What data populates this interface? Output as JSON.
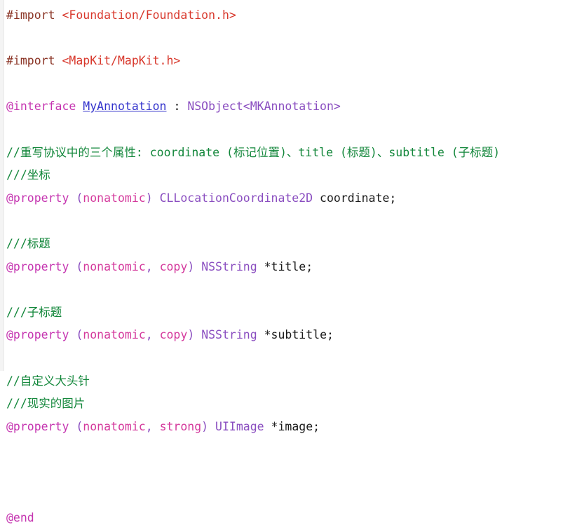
{
  "document": {
    "language": "Objective-C",
    "kind": "header-file",
    "colors": {
      "background": "#ffffff",
      "gutter": "#f4f4f4",
      "preprocessor": "#8a3324",
      "header_path": "#d8372b",
      "keyword": "#c534b0",
      "class_link": "#3333cc",
      "type": "#8a4ec0",
      "property_attribute": "#d4399c",
      "plain_text": "#1a1a1a",
      "comment": "#13873b"
    }
  },
  "code": {
    "lines": [
      {
        "index": 0,
        "plain": "#import <Foundation/Foundation.h>",
        "tokens": [
          {
            "text": "#import",
            "type": "preproc"
          },
          {
            "text": " ",
            "type": "plain"
          },
          {
            "text": "<Foundation/Foundation.h>",
            "type": "header"
          }
        ]
      },
      {
        "index": 1,
        "plain": "",
        "tokens": []
      },
      {
        "index": 2,
        "plain": "#import <MapKit/MapKit.h>",
        "tokens": [
          {
            "text": "#import",
            "type": "preproc"
          },
          {
            "text": " ",
            "type": "plain"
          },
          {
            "text": "<MapKit/MapKit.h>",
            "type": "header"
          }
        ]
      },
      {
        "index": 3,
        "plain": "",
        "tokens": []
      },
      {
        "index": 4,
        "plain": "@interface MyAnnotation : NSObject<MKAnnotation>",
        "tokens": [
          {
            "text": "@interface",
            "type": "keyword"
          },
          {
            "text": " ",
            "type": "plain"
          },
          {
            "text": "MyAnnotation",
            "type": "classname"
          },
          {
            "text": " ",
            "type": "plain"
          },
          {
            "text": ":",
            "type": "plain"
          },
          {
            "text": " ",
            "type": "plain"
          },
          {
            "text": "NSObject<MKAnnotation>",
            "type": "type"
          }
        ]
      },
      {
        "index": 5,
        "plain": "",
        "tokens": []
      },
      {
        "index": 6,
        "plain": "//重写协议中的三个属性: coordinate (标记位置)、title (标题)、subtitle (子标题)",
        "tokens": [
          {
            "text": "//重写协议中的三个属性: coordinate (标记位置)、title (标题)、subtitle (子标题)",
            "type": "comment"
          }
        ]
      },
      {
        "index": 7,
        "plain": "///坐标",
        "tokens": [
          {
            "text": "///坐标",
            "type": "comment"
          }
        ]
      },
      {
        "index": 8,
        "plain": "@property (nonatomic) CLLocationCoordinate2D coordinate;",
        "tokens": [
          {
            "text": "@property",
            "type": "keyword"
          },
          {
            "text": " ",
            "type": "plain"
          },
          {
            "text": "(",
            "type": "punct"
          },
          {
            "text": "nonatomic",
            "type": "attr"
          },
          {
            "text": ")",
            "type": "punct"
          },
          {
            "text": " ",
            "type": "plain"
          },
          {
            "text": "CLLocationCoordinate2D",
            "type": "type"
          },
          {
            "text": " ",
            "type": "plain"
          },
          {
            "text": "coordinate;",
            "type": "plain"
          }
        ]
      },
      {
        "index": 9,
        "plain": "",
        "tokens": []
      },
      {
        "index": 10,
        "plain": "///标题",
        "tokens": [
          {
            "text": "///标题",
            "type": "comment"
          }
        ]
      },
      {
        "index": 11,
        "plain": "@property (nonatomic, copy) NSString *title;",
        "tokens": [
          {
            "text": "@property",
            "type": "keyword"
          },
          {
            "text": " ",
            "type": "plain"
          },
          {
            "text": "(",
            "type": "punct"
          },
          {
            "text": "nonatomic",
            "type": "attr"
          },
          {
            "text": ",",
            "type": "punct"
          },
          {
            "text": " ",
            "type": "plain"
          },
          {
            "text": "copy",
            "type": "attr"
          },
          {
            "text": ")",
            "type": "punct"
          },
          {
            "text": " ",
            "type": "plain"
          },
          {
            "text": "NSString",
            "type": "type"
          },
          {
            "text": " ",
            "type": "plain"
          },
          {
            "text": "*title;",
            "type": "plain"
          }
        ]
      },
      {
        "index": 12,
        "plain": "",
        "tokens": []
      },
      {
        "index": 13,
        "plain": "///子标题",
        "tokens": [
          {
            "text": "///子标题",
            "type": "comment"
          }
        ]
      },
      {
        "index": 14,
        "plain": "@property (nonatomic, copy) NSString *subtitle;",
        "tokens": [
          {
            "text": "@property",
            "type": "keyword"
          },
          {
            "text": " ",
            "type": "plain"
          },
          {
            "text": "(",
            "type": "punct"
          },
          {
            "text": "nonatomic",
            "type": "attr"
          },
          {
            "text": ",",
            "type": "punct"
          },
          {
            "text": " ",
            "type": "plain"
          },
          {
            "text": "copy",
            "type": "attr"
          },
          {
            "text": ")",
            "type": "punct"
          },
          {
            "text": " ",
            "type": "plain"
          },
          {
            "text": "NSString",
            "type": "type"
          },
          {
            "text": " ",
            "type": "plain"
          },
          {
            "text": "*subtitle;",
            "type": "plain"
          }
        ]
      },
      {
        "index": 15,
        "plain": "",
        "tokens": []
      },
      {
        "index": 16,
        "plain": "//自定义大头针",
        "tokens": [
          {
            "text": "//自定义大头针",
            "type": "comment"
          }
        ]
      },
      {
        "index": 17,
        "plain": "///现实的图片",
        "tokens": [
          {
            "text": "///现实的图片",
            "type": "comment"
          }
        ]
      },
      {
        "index": 18,
        "plain": "@property (nonatomic, strong) UIImage *image;",
        "tokens": [
          {
            "text": "@property",
            "type": "keyword"
          },
          {
            "text": " ",
            "type": "plain"
          },
          {
            "text": "(",
            "type": "punct"
          },
          {
            "text": "nonatomic",
            "type": "attr"
          },
          {
            "text": ",",
            "type": "punct"
          },
          {
            "text": " ",
            "type": "plain"
          },
          {
            "text": "strong",
            "type": "attr"
          },
          {
            "text": ")",
            "type": "punct"
          },
          {
            "text": " ",
            "type": "plain"
          },
          {
            "text": "UIImage",
            "type": "type"
          },
          {
            "text": " ",
            "type": "plain"
          },
          {
            "text": "*image;",
            "type": "plain"
          }
        ]
      },
      {
        "index": 19,
        "plain": "",
        "tokens": []
      },
      {
        "index": 20,
        "plain": "",
        "tokens": []
      },
      {
        "index": 21,
        "plain": "",
        "tokens": []
      },
      {
        "index": 22,
        "plain": "@end",
        "tokens": [
          {
            "text": "@end",
            "type": "keyword"
          }
        ]
      }
    ]
  }
}
